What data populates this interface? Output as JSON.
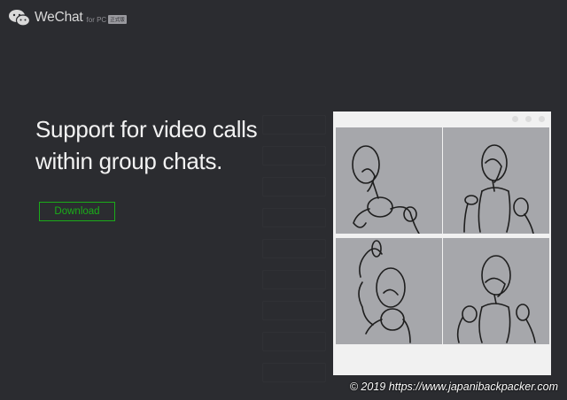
{
  "header": {
    "logo_icon": "wechat-logo-icon",
    "brand": "WeChat",
    "sub": "for PC",
    "badge": "正式版"
  },
  "hero": {
    "headline_line1": "Support for video calls",
    "headline_line2": "within group chats.",
    "download_label": "Download"
  },
  "preview": {
    "tiles": [
      "sketch-figure-1",
      "sketch-figure-2",
      "sketch-figure-3",
      "sketch-figure-4"
    ]
  },
  "watermark": "© 2019 https://www.japanibackpacker.com",
  "colors": {
    "background": "#2b2c30",
    "accent_green": "#1aad19",
    "headline": "#f2f2f2"
  }
}
